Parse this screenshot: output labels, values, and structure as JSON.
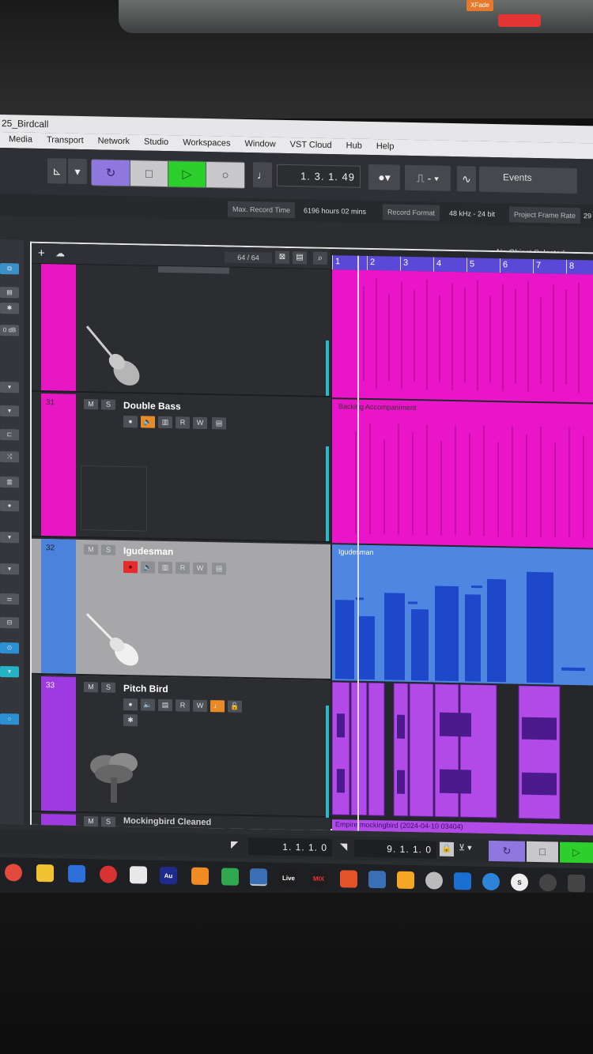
{
  "project_title": "25_Birdcall",
  "menu": [
    "Media",
    "Transport",
    "Network",
    "Studio",
    "Workspaces",
    "Window",
    "VST Cloud",
    "Hub",
    "Help"
  ],
  "top_badge": "XFade",
  "toolbar": {
    "position": "1. 3. 1. 49",
    "events_label": "Events",
    "max_record_label": "Max. Record Time",
    "max_record_value": "6196 hours 02 mins",
    "record_format_label": "Record Format",
    "record_format_value": "48 kHz - 24 bit",
    "frame_rate_label": "Project Frame Rate",
    "frame_rate_value": "29"
  },
  "inspector": {
    "db_label": "0 dB"
  },
  "no_object": "No Object Selected",
  "track_list": {
    "count": "64 / 64",
    "tracks": [
      {
        "number": "31",
        "name": "Double Bass",
        "color": "#e817c4",
        "m": "M",
        "s": "S",
        "r": "R",
        "w": "W"
      },
      {
        "number": "32",
        "name": "Igudesman",
        "color": "#4a82dc",
        "m": "M",
        "s": "S",
        "r": "R",
        "w": "W"
      },
      {
        "number": "33",
        "name": "Pitch Bird",
        "color": "#9d3ae0",
        "m": "M",
        "s": "S",
        "r": "R",
        "w": "W"
      },
      {
        "number": "",
        "name": "Mockingbird Cleaned",
        "color": "#9d3ae0",
        "m": "M",
        "s": "S"
      }
    ]
  },
  "ruler": [
    "1",
    "2",
    "3",
    "4",
    "5",
    "6",
    "7",
    "8"
  ],
  "parts": {
    "backing": "Backing Accompaniment",
    "igudesman": "Igudesman",
    "bottom_clip": "Empire mockingbird (2024-04-10 03404)"
  },
  "bottom": {
    "left_locator": "1. 1. 1. 0",
    "right_locator": "9. 1. 1. 0"
  },
  "taskbar_apps": [
    "Au",
    "Live",
    "MIX"
  ]
}
